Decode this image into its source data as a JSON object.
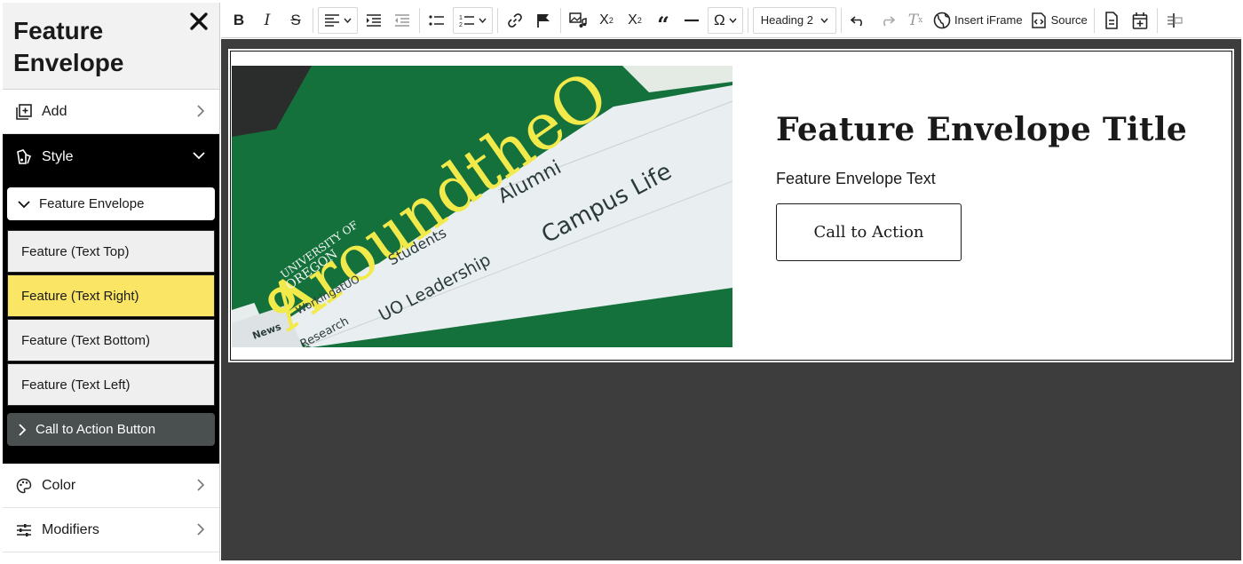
{
  "sidebar": {
    "title": "Feature Envelope",
    "add_label": "Add",
    "style_label": "Style",
    "feature_envelope_label": "Feature Envelope",
    "options": [
      "Feature (Text Top)",
      "Feature (Text Right)",
      "Feature (Text Bottom)",
      "Feature (Text Left)"
    ],
    "selected_option": "Feature (Text Right)",
    "cta_label": "Call to Action Button",
    "color_label": "Color",
    "modifiers_label": "Modifiers"
  },
  "toolbar": {
    "heading_select": "Heading 2",
    "insert_iframe_label": "Insert iFrame",
    "source_label": "Source"
  },
  "content": {
    "title": "Feature Envelope Title",
    "text": "Feature Envelope Text",
    "cta": "Call to Action",
    "image": {
      "site_title": "AroundtheO",
      "university": "UNIVERSITY OF",
      "university2": "OREGON",
      "nav": [
        "Alumni",
        "Students",
        "Campus Life",
        "WorkingatUO",
        "UO Leadership",
        "News",
        "Research"
      ]
    }
  },
  "colors": {
    "selected_option_bg": "#fbe565",
    "uo_green": "#15713b",
    "uo_yellow": "#f2e94a",
    "editor_bg": "#3d3d3d"
  }
}
